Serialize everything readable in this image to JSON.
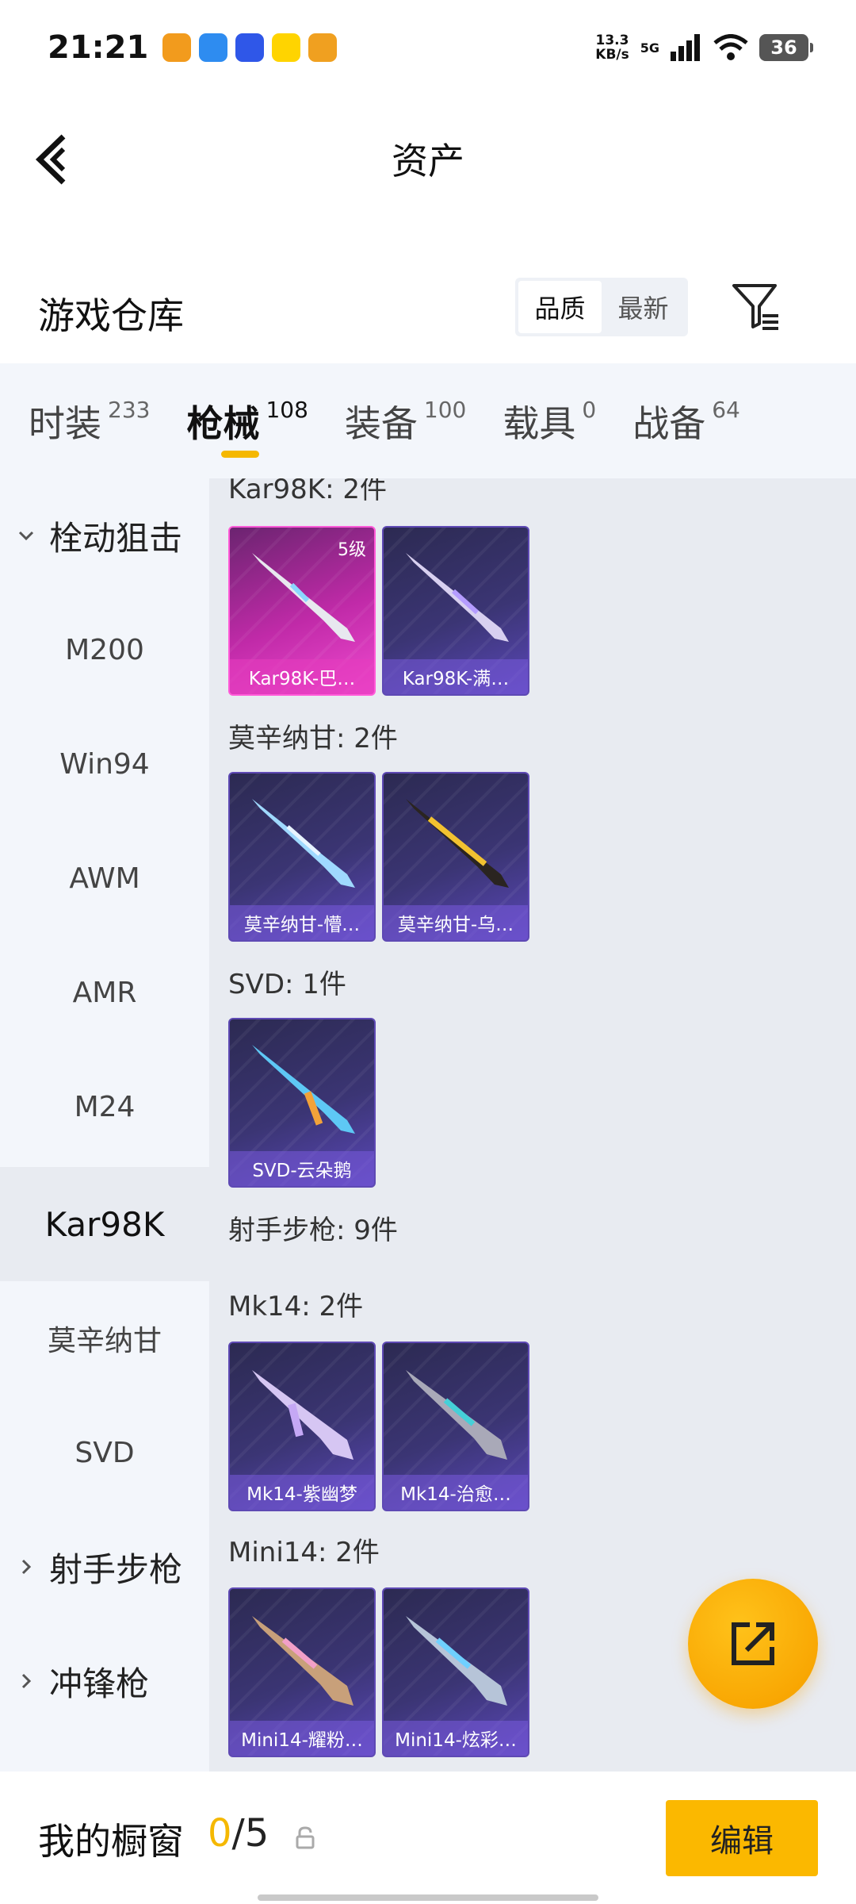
{
  "status_bar": {
    "time": "21:21",
    "net_speed_value": "13.3",
    "net_speed_unit": "KB/s",
    "network": "5G",
    "battery": "36"
  },
  "header": {
    "title": "资产"
  },
  "warehouse": {
    "title": "游戏仓库",
    "sort_options": [
      "品质",
      "最新"
    ],
    "active_sort": "品质"
  },
  "tabs": [
    {
      "label": "时装",
      "count": "233"
    },
    {
      "label": "枪械",
      "count": "108",
      "active": true
    },
    {
      "label": "装备",
      "count": "100"
    },
    {
      "label": "载具",
      "count": "0"
    },
    {
      "label": "战备",
      "count": "64"
    }
  ],
  "sidebar": {
    "items": [
      {
        "label": "栓动狙击",
        "type": "group-expanded"
      },
      {
        "label": "M200"
      },
      {
        "label": "Win94"
      },
      {
        "label": "AWM"
      },
      {
        "label": "AMR"
      },
      {
        "label": "M24"
      },
      {
        "label": "Kar98K",
        "active": true
      },
      {
        "label": "莫辛纳甘"
      },
      {
        "label": "SVD"
      },
      {
        "label": "射手步枪",
        "type": "group-collapsed"
      },
      {
        "label": "冲锋枪",
        "type": "group-collapsed"
      }
    ]
  },
  "content": {
    "sections": [
      {
        "title": "Kar98K: 2件",
        "cards": [
          {
            "name": "Kar98K-巴…",
            "level": "5级",
            "rarity": "pink"
          },
          {
            "name": "Kar98K-满…",
            "rarity": "purple"
          }
        ]
      },
      {
        "title": "莫辛纳甘: 2件",
        "cards": [
          {
            "name": "莫辛纳甘-懵…",
            "rarity": "purple"
          },
          {
            "name": "莫辛纳甘-乌…",
            "rarity": "purple"
          }
        ]
      },
      {
        "title": "SVD: 1件",
        "cards": [
          {
            "name": "SVD-云朵鹅",
            "rarity": "purple"
          }
        ]
      },
      {
        "title": "射手步枪: 9件",
        "cards": []
      },
      {
        "title": "Mk14: 2件",
        "cards": [
          {
            "name": "Mk14-紫幽梦",
            "rarity": "purple"
          },
          {
            "name": "Mk14-治愈…",
            "rarity": "purple"
          }
        ]
      },
      {
        "title": "Mini14: 2件",
        "cards": [
          {
            "name": "Mini14-耀粉…",
            "rarity": "purple"
          },
          {
            "name": "Mini14-炫彩…",
            "rarity": "purple"
          }
        ]
      }
    ]
  },
  "bottom_bar": {
    "label": "我的橱窗",
    "current": "0",
    "separator_total": "/5",
    "edit_label": "编辑"
  },
  "colors": {
    "accent": "#f5b800",
    "tab_bg": "#f3f6fb",
    "content_bg": "#e8ebf1",
    "card_purple": "#3b3574",
    "card_pink": "#c02aa8"
  },
  "icons": [
    "back-arrow-icon",
    "filter-icon",
    "chevron-down-icon",
    "chevron-right-icon",
    "share-icon",
    "lock-icon",
    "wifi-icon",
    "signal-icon"
  ]
}
